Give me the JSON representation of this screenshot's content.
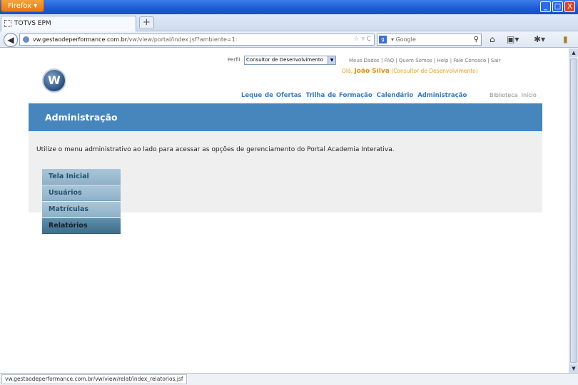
{
  "browser": {
    "menu_button": "Firefox",
    "window_controls": {
      "minimize": "_",
      "maximize": "□",
      "close": "X"
    },
    "tab": {
      "title": "TOTVS EPM"
    },
    "new_tab": "+",
    "url": {
      "domain": "vw.gestaodeperformance.com.br",
      "path": "/vw/view/portal/index.jsf?ambiente=1:"
    },
    "search": {
      "engine_icon": "google-icon",
      "placeholder": "Google"
    },
    "status_bar": "vw.gestaodeperformance.com.br/vw/view/relat/index_relatorios.jsf"
  },
  "header": {
    "perfil_label": "Perfil",
    "perfil_value": "Consultor de Desenvolvimento",
    "top_links": [
      "Meus Dados",
      "FAQ",
      "Quem Somos",
      "Help",
      "Fale Conosco",
      "Sair"
    ],
    "greeting_prefix": "Olá,",
    "user_name": "João Silva",
    "user_role": "(Consultor de Desenvolvimento)",
    "main_nav": [
      "Leque de Ofertas",
      "Trilha de Formação",
      "Calendário",
      "Administração"
    ],
    "right_nav": [
      "Biblioteca",
      "Início"
    ]
  },
  "page": {
    "title": "Administração",
    "intro": "Utilize o menu administrativo ao lado para acessar as opções de gerenciamento do Portal Academia Interativa.",
    "menu": [
      "Tela Inicial",
      "Usuários",
      "Matrículas",
      "Relatórios"
    ],
    "active_menu": "Relatórios"
  },
  "colors": {
    "banner": "#4786bd",
    "nav_link": "#3d79b6",
    "greeting": "#e79a1e",
    "menu_item": "#99bbd0"
  }
}
